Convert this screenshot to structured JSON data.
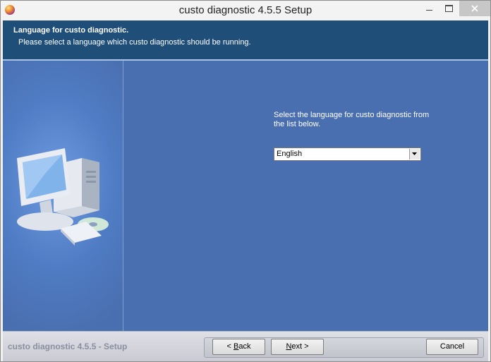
{
  "window": {
    "title": "custo diagnostic 4.5.5 Setup"
  },
  "header": {
    "title": "Language for custo diagnostic.",
    "subtitle": "Please select a language which custo diagnostic should be running."
  },
  "main": {
    "prompt": "Select the language for custo diagnostic from the list below.",
    "language_select": {
      "selected": "English"
    }
  },
  "footer": {
    "brand": "custo diagnostic 4.5.5 - Setup",
    "back": {
      "mnemonic": "B",
      "rest": "ack",
      "prefix": "< ",
      "suffix": ""
    },
    "next": {
      "mnemonic": "N",
      "rest": "ext",
      "prefix": "",
      "suffix": " >"
    },
    "cancel": "Cancel"
  },
  "icons": {
    "app": "installer-icon",
    "minimize": "minimize-icon",
    "maximize": "maximize-icon",
    "close": "close-icon",
    "dropdown": "chevron-down-icon",
    "illustration": "computer-illustration"
  }
}
